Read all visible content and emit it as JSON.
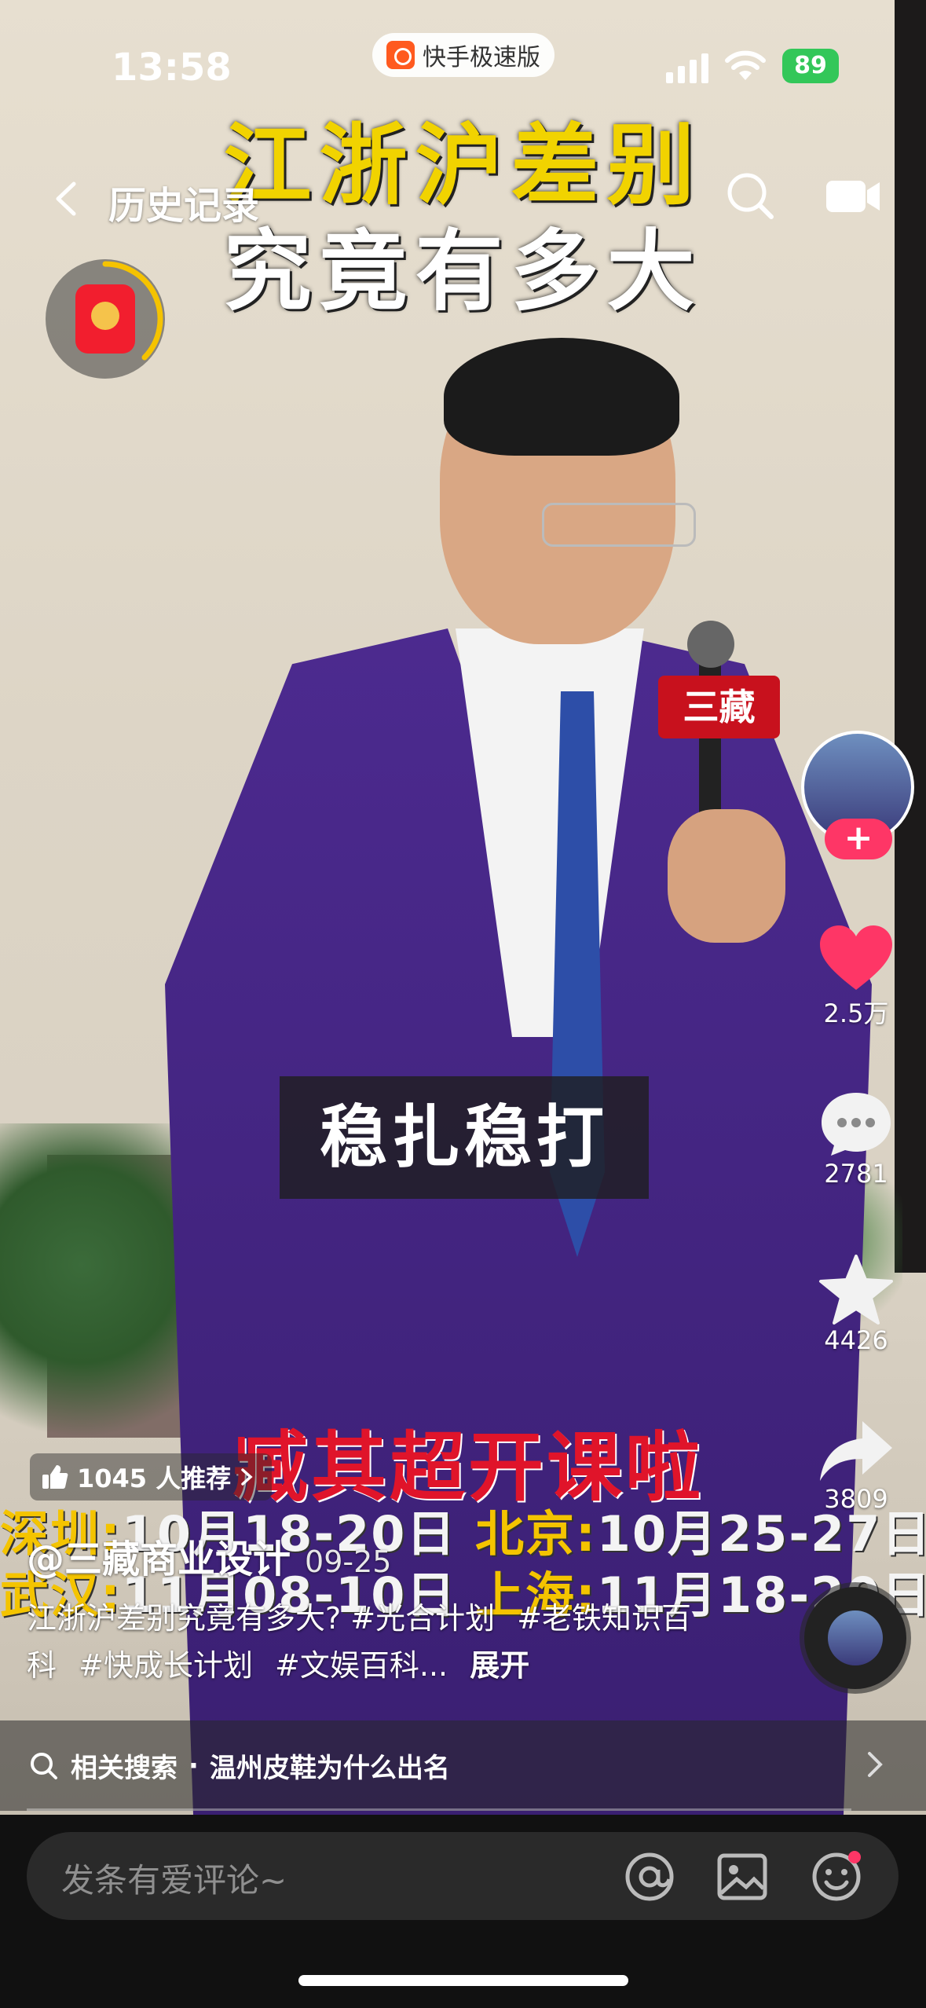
{
  "status_bar": {
    "time": "13:58",
    "app_name": "快手极速版",
    "battery": "89"
  },
  "nav": {
    "title": "历史记录",
    "back_icon": "chevron-left-icon",
    "search_icon": "search-icon",
    "video_icon": "video-camera-icon"
  },
  "video_overlay": {
    "headline_line1": "江浙沪差别",
    "headline_line2": "究竟有多大",
    "subtitle": "稳扎稳打",
    "course_banner": "臧其超开课啦",
    "schedule": [
      {
        "city": "深圳:",
        "dates": "10月18-20日"
      },
      {
        "city": "北京:",
        "dates": "10月25-27日"
      },
      {
        "city": "武汉:",
        "dates": "11月08-10日"
      },
      {
        "city": "上海:",
        "dates": "11月18-20日"
      }
    ],
    "mic_brand": "三藏"
  },
  "actions": {
    "follow_plus": "+",
    "likes": "2.5万",
    "comments": "2781",
    "favorites": "4426",
    "shares": "3809"
  },
  "info": {
    "recommend": "1045 人推荐",
    "author": "@三藏商业设计",
    "date": "09-25",
    "desc_text": "江浙沪差别究竟有多大?",
    "tags": [
      "#光合计划",
      "#老铁知识百科",
      "#快成长计划",
      "#文娱百科..."
    ],
    "expand": "展开"
  },
  "related": {
    "prefix": "相关搜索",
    "query": "温州皮鞋为什么出名"
  },
  "comment_bar": {
    "placeholder": "发条有爱评论~"
  },
  "colors": {
    "accent_red": "#fe3666",
    "headline_yellow": "#f1d300",
    "battery_green": "#33c759"
  }
}
